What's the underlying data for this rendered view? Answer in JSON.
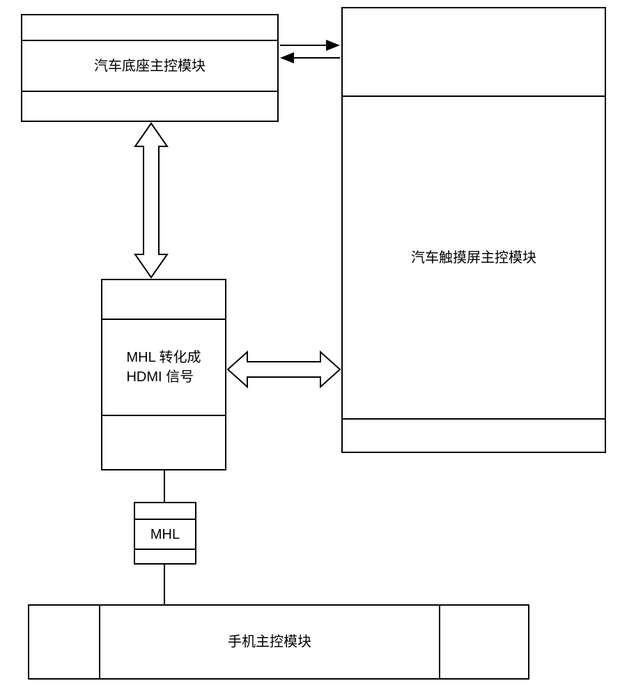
{
  "boxes": {
    "base_controller": "汽车底座主控模块",
    "touchscreen_controller": "汽车触摸屏主控模块",
    "mhl_converter": "MHL 转化成\nHDMI 信号",
    "mhl_port": "MHL",
    "phone_controller": "手机主控模块"
  }
}
